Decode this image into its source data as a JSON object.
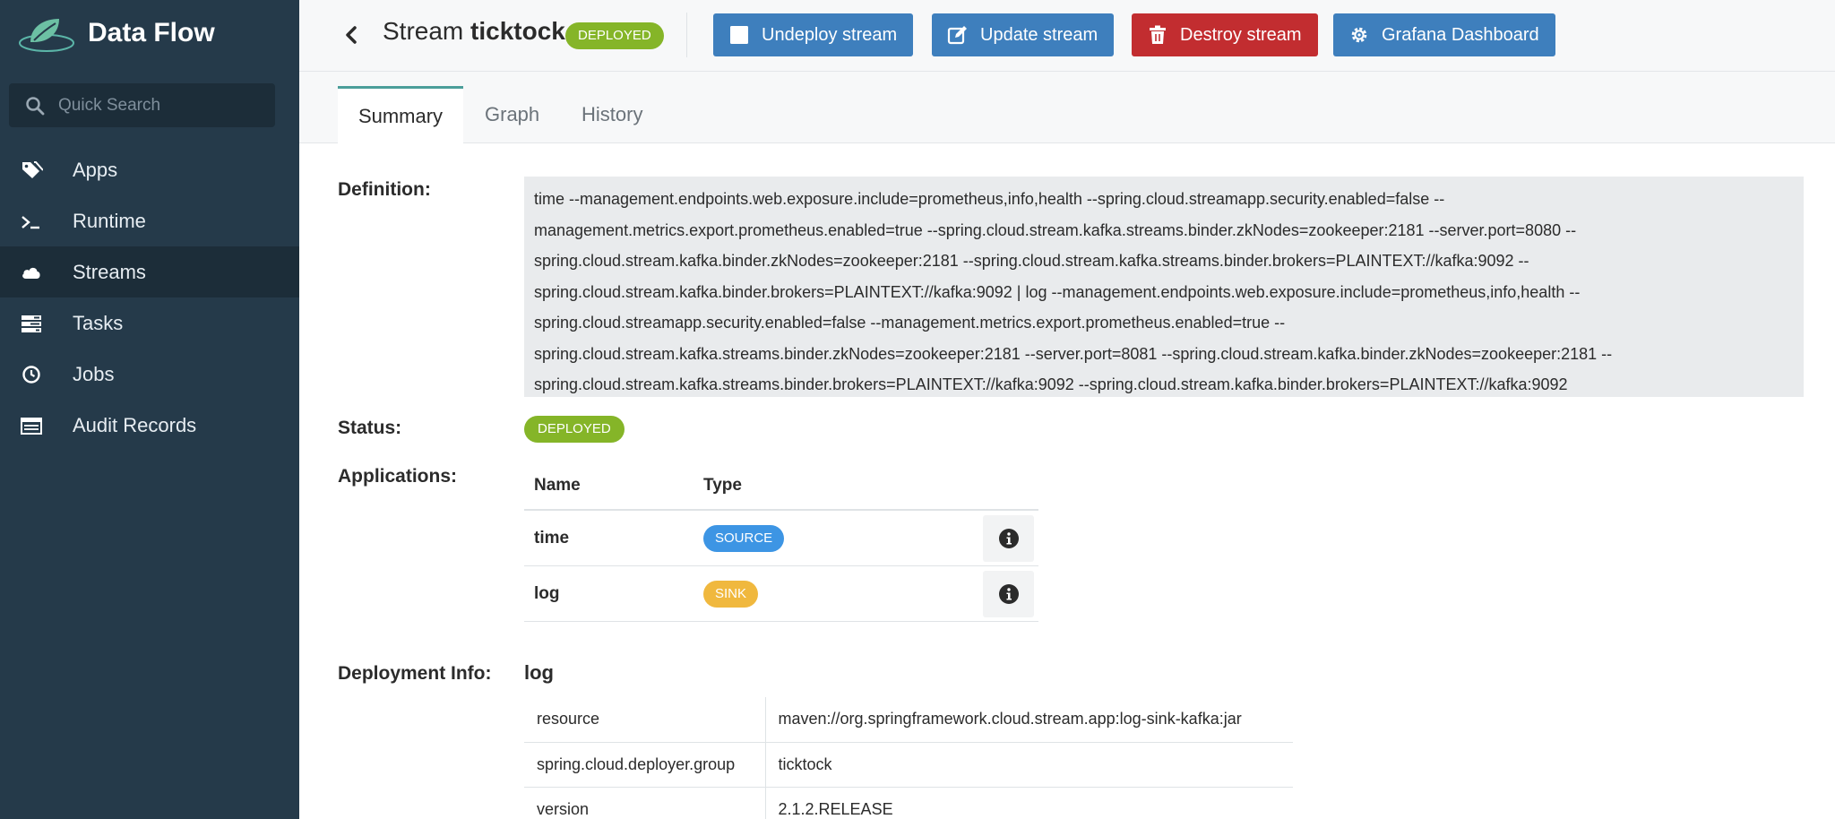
{
  "app": {
    "name": "Data Flow"
  },
  "search": {
    "placeholder": "Quick Search"
  },
  "nav": {
    "items": [
      {
        "label": "Apps",
        "icon": "tags-icon",
        "active": false
      },
      {
        "label": "Runtime",
        "icon": "terminal-icon",
        "active": false
      },
      {
        "label": "Streams",
        "icon": "cloud-icon",
        "active": true
      },
      {
        "label": "Tasks",
        "icon": "tasks-icon",
        "active": false
      },
      {
        "label": "Jobs",
        "icon": "clock-icon",
        "active": false
      },
      {
        "label": "Audit Records",
        "icon": "list-icon",
        "active": false
      }
    ]
  },
  "header": {
    "title_prefix": "Stream",
    "stream_name": "ticktock",
    "status_badge": "DEPLOYED",
    "buttons": {
      "undeploy": "Undeploy stream",
      "update": "Update stream",
      "destroy": "Destroy stream",
      "grafana": "Grafana Dashboard"
    }
  },
  "tabs": [
    {
      "label": "Summary",
      "active": true
    },
    {
      "label": "Graph",
      "active": false
    },
    {
      "label": "History",
      "active": false
    }
  ],
  "summary": {
    "definition_label": "Definition:",
    "definition_lines": [
      "time --management.endpoints.web.exposure.include=prometheus,info,health --spring.cloud.streamapp.security.enabled=false --",
      "management.metrics.export.prometheus.enabled=true --spring.cloud.stream.kafka.streams.binder.zkNodes=zookeeper:2181 --server.port=8080 --",
      "spring.cloud.stream.kafka.binder.zkNodes=zookeeper:2181 --spring.cloud.stream.kafka.streams.binder.brokers=PLAINTEXT://kafka:9092 --",
      "spring.cloud.stream.kafka.binder.brokers=PLAINTEXT://kafka:9092 | log --management.endpoints.web.exposure.include=prometheus,info,health --",
      "spring.cloud.streamapp.security.enabled=false --management.metrics.export.prometheus.enabled=true --",
      "spring.cloud.stream.kafka.streams.binder.zkNodes=zookeeper:2181 --server.port=8081 --spring.cloud.stream.kafka.binder.zkNodes=zookeeper:2181 --",
      "spring.cloud.stream.kafka.streams.binder.brokers=PLAINTEXT://kafka:9092 --spring.cloud.stream.kafka.binder.brokers=PLAINTEXT://kafka:9092"
    ],
    "status_label": "Status:",
    "status": "DEPLOYED",
    "applications_label": "Applications:",
    "applications_headers": {
      "name": "Name",
      "type": "Type"
    },
    "applications": [
      {
        "name": "time",
        "type": "SOURCE"
      },
      {
        "name": "log",
        "type": "SINK"
      }
    ],
    "deployment_label": "Deployment Info:",
    "deployment_app": "log",
    "deployment_rows": [
      {
        "key": "resource",
        "value": "maven://org.springframework.cloud.stream.app:log-sink-kafka:jar"
      },
      {
        "key": "spring.cloud.deployer.group",
        "value": "ticktock"
      },
      {
        "key": "version",
        "value": "2.1.2.RELEASE"
      }
    ]
  },
  "colors": {
    "sidebar": "#253a4a",
    "deployed": "#85b528",
    "source": "#3d95e4",
    "sink": "#f0b83e",
    "primary_button": "#3e7fbd",
    "danger_button": "#c22d30"
  }
}
